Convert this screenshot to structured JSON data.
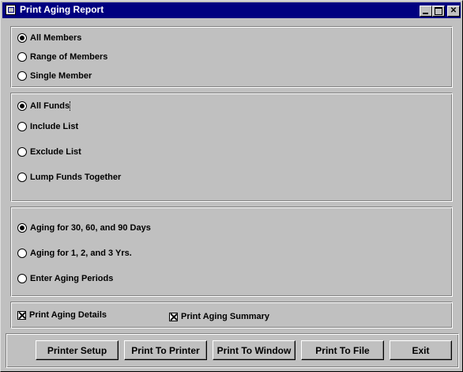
{
  "window": {
    "title": "Print Aging Report"
  },
  "members": {
    "options": [
      "All Members",
      "Range of Members",
      "Single Member"
    ],
    "selected": 0
  },
  "funds": {
    "options": [
      "All Funds",
      "Include List",
      "Exclude List",
      "Lump Funds Together"
    ],
    "selected": 0
  },
  "aging": {
    "options": [
      "Aging for 30, 60, and 90 Days",
      "Aging for 1, 2, and 3 Yrs.",
      "Enter Aging Periods"
    ],
    "selected": 0
  },
  "print_options": {
    "details_label": "Print Aging Details",
    "details_checked": true,
    "summary_label": "Print Aging Summary",
    "summary_checked": true
  },
  "buttons": {
    "printer_setup": "Printer Setup",
    "print_to_printer": "Print To Printer",
    "print_to_window": "Print To Window",
    "print_to_file": "Print To File",
    "exit": "Exit"
  }
}
